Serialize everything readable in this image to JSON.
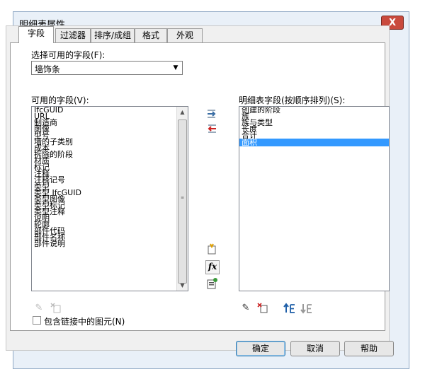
{
  "window": {
    "title": "明细表属性",
    "close_label": "X"
  },
  "tabs": [
    {
      "label": "字段"
    },
    {
      "label": "过滤器"
    },
    {
      "label": "排序/成组"
    },
    {
      "label": "格式"
    },
    {
      "label": "外观"
    }
  ],
  "select_fields": {
    "label": "选择可用的字段(F):",
    "value": "墙饰条"
  },
  "available": {
    "label": "可用的字段(V):",
    "items": [
      "IfcGUID",
      "URL",
      "制造商",
      "图像",
      "型号",
      "墙的子类别",
      "成本",
      "拆除的阶段",
      "材质",
      "标记",
      "注释",
      "注释记号",
      "类型",
      "类型 IfcGUID",
      "类型图像",
      "类型标记",
      "类型注释",
      "说明",
      "轮廓",
      "部件代码",
      "部件名称",
      "部件说明"
    ]
  },
  "scheduled": {
    "label": "明细表字段(按顺序排列)(S):",
    "items": [
      "创建的阶段",
      "族",
      "族与类型",
      "长度",
      "合计",
      "面积"
    ],
    "selected_index": 5
  },
  "include_linked": {
    "label": "包含链接中的图元(N)"
  },
  "buttons": {
    "ok": "确定",
    "cancel": "取消",
    "help": "帮助"
  },
  "colors": {
    "selection": "#3399ff",
    "add_arrow": "#3a6ea5",
    "remove_arrow": "#cc2222"
  }
}
